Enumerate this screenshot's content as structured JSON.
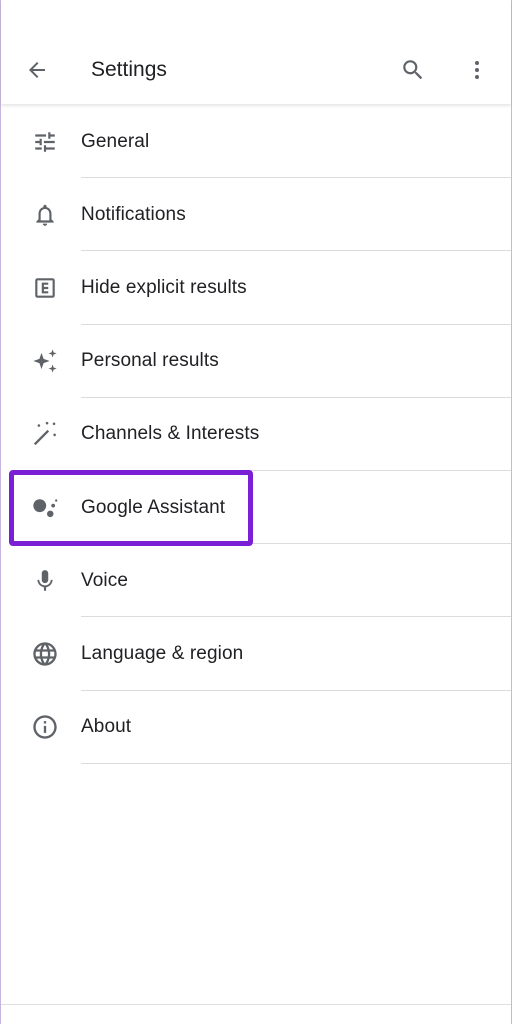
{
  "appbar": {
    "title": "Settings",
    "icons": {
      "back": "arrow-back-icon",
      "search": "search-icon",
      "more": "more-vert-icon"
    }
  },
  "settings": {
    "items": [
      {
        "label": "General",
        "icon": "tune-icon"
      },
      {
        "label": "Notifications",
        "icon": "bell-icon"
      },
      {
        "label": "Hide explicit results",
        "icon": "explicit-icon"
      },
      {
        "label": "Personal results",
        "icon": "sparkle-icon"
      },
      {
        "label": "Channels & Interests",
        "icon": "magic-wand-icon"
      },
      {
        "label": "Google Assistant",
        "icon": "assistant-icon",
        "highlighted": true
      },
      {
        "label": "Voice",
        "icon": "mic-icon"
      },
      {
        "label": "Language & region",
        "icon": "globe-icon"
      },
      {
        "label": "About",
        "icon": "info-icon"
      }
    ]
  },
  "colors": {
    "icon": "#5f6368",
    "text": "#202124",
    "divider": "#dadce0",
    "highlight": "#7a1fd6"
  }
}
